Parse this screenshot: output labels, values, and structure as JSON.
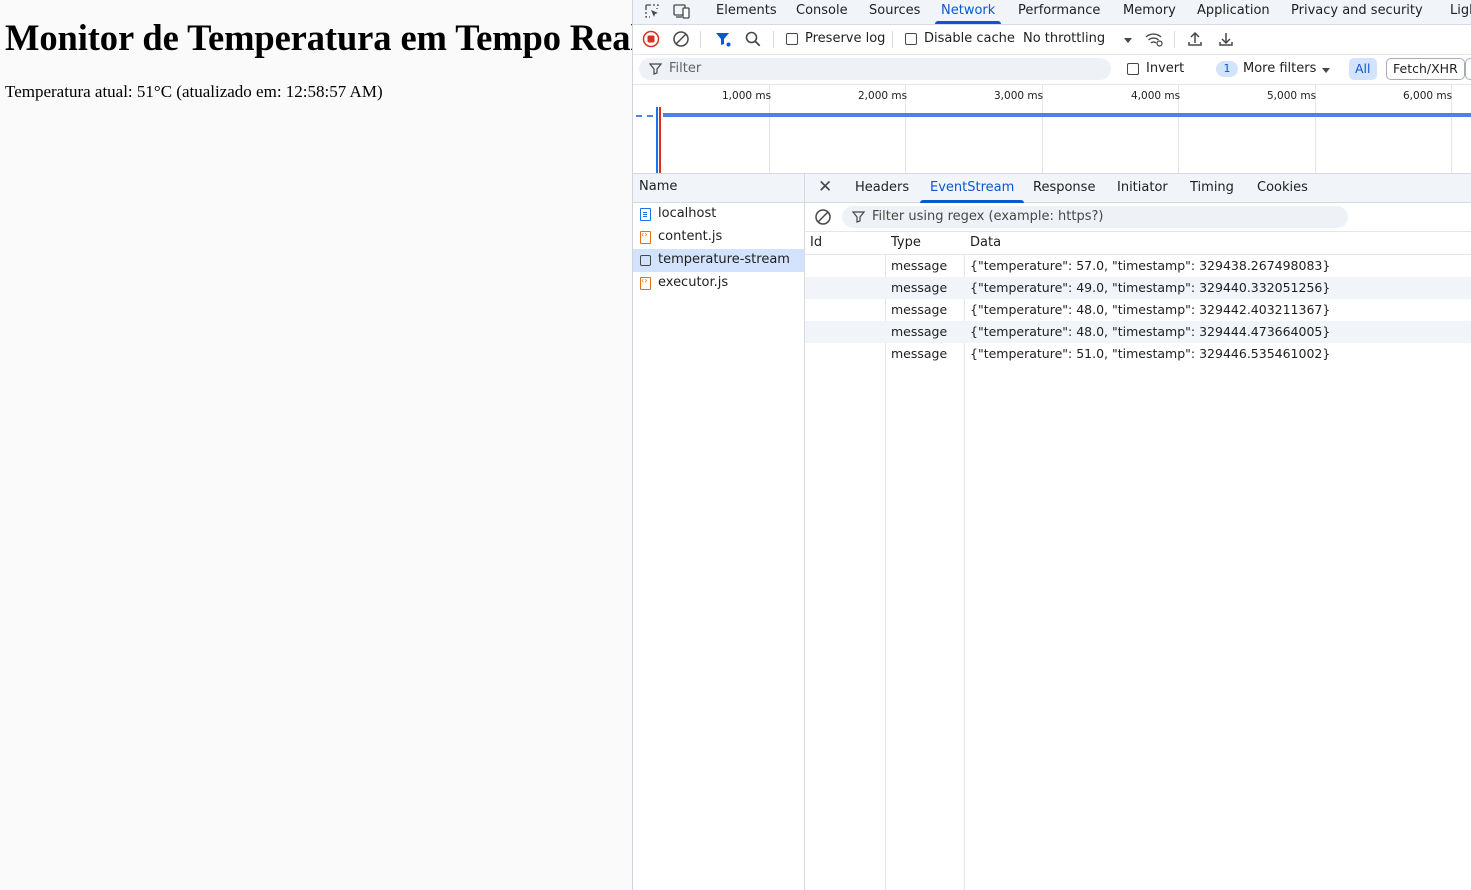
{
  "page": {
    "heading": "Monitor de Temperatura em Tempo Real",
    "status_text": "Temperatura atual: 51°C (atualizado em: 12:58:57 AM)"
  },
  "devtools": {
    "main_tabs": [
      "Elements",
      "Console",
      "Sources",
      "Network",
      "Performance",
      "Memory",
      "Application",
      "Privacy and security",
      "Ligh"
    ],
    "active_tab": "Network",
    "toolbar": {
      "preserve_log": "Preserve log",
      "disable_cache": "Disable cache",
      "throttling": "No throttling"
    },
    "filter": {
      "placeholder": "Filter",
      "invert": "Invert",
      "more_filters_count": "1",
      "more_filters": "More filters",
      "type_all": "All",
      "type_fetch": "Fetch/XHR"
    },
    "timeline_ticks": [
      "1,000 ms",
      "2,000 ms",
      "3,000 ms",
      "4,000 ms",
      "5,000 ms",
      "6,000 ms"
    ],
    "requests": {
      "header": "Name",
      "items": [
        {
          "name": "localhost",
          "icon": "document-icon"
        },
        {
          "name": "content.js",
          "icon": "script-icon"
        },
        {
          "name": "temperature-stream",
          "icon": "eventstream-icon",
          "selected": true
        },
        {
          "name": "executor.js",
          "icon": "script-icon"
        }
      ]
    },
    "detail_tabs": [
      "Headers",
      "EventStream",
      "Response",
      "Initiator",
      "Timing",
      "Cookies"
    ],
    "active_detail_tab": "EventStream",
    "eventstream": {
      "filter_placeholder": "Filter using regex (example: https?)",
      "columns": [
        "Id",
        "Type",
        "Data"
      ],
      "rows": [
        {
          "id": "",
          "type": "message",
          "data": "{\"temperature\": 57.0, \"timestamp\": 329438.267498083}"
        },
        {
          "id": "",
          "type": "message",
          "data": "{\"temperature\": 49.0, \"timestamp\": 329440.332051256}"
        },
        {
          "id": "",
          "type": "message",
          "data": "{\"temperature\": 48.0, \"timestamp\": 329442.403211367}"
        },
        {
          "id": "",
          "type": "message",
          "data": "{\"temperature\": 48.0, \"timestamp\": 329444.473664005}"
        },
        {
          "id": "",
          "type": "message",
          "data": "{\"temperature\": 51.0, \"timestamp\": 329446.535461002}"
        }
      ]
    },
    "colors": {
      "accent": "#0b57d0",
      "selected_row": "#d3e3fd",
      "record": "#d93025"
    }
  }
}
